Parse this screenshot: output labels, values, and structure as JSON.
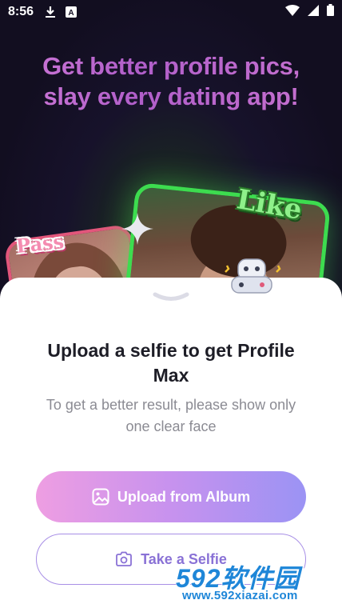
{
  "status_bar": {
    "time": "8:56",
    "icons": [
      "download-icon",
      "a-notification-icon",
      "wifi-icon",
      "signal-icon",
      "battery-icon"
    ]
  },
  "hero": {
    "title_line1": "Get better profile pics,",
    "title_line2": "slay every dating app!",
    "sticker_pass": "Pass",
    "sticker_like": "Like"
  },
  "sheet": {
    "title_line1": "Upload a selfie to get Profile",
    "title_line2": "Max",
    "subtitle_line1": "To get a better result, please show only",
    "subtitle_line2": "one clear face",
    "upload_label": "Upload from Album",
    "selfie_label": "Take a Selfie"
  },
  "watermark": {
    "main": "592软件园",
    "url": "www.592xiazai.com"
  },
  "colors": {
    "title_gradient_start": "#d07ad8",
    "upload_gradient_start": "#ee9ee2",
    "upload_gradient_end": "#9b93f4",
    "selfie_border": "#a88fe6",
    "like_border": "#3ddc4f",
    "pass_border": "#e2567b",
    "watermark": "#1e86d8"
  }
}
